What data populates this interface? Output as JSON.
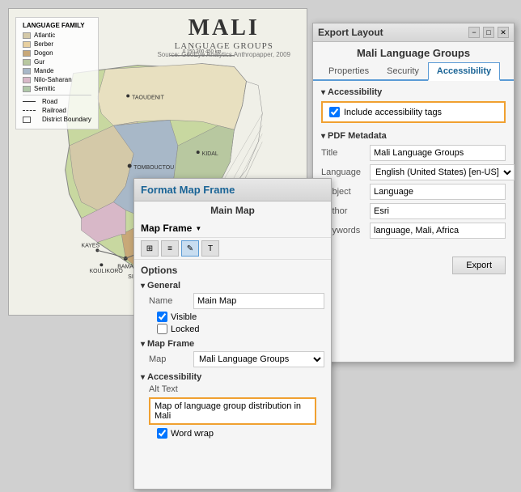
{
  "mali_map": {
    "title": "MALI",
    "subtitle": "LANGUAGE GROUPS",
    "source": "Source: GeoEye Analytics Anthropapper, 2009",
    "legend": {
      "title": "LANGUAGE FAMILY",
      "items": [
        {
          "color": "#d4c9a8",
          "label": "Atlantic"
        },
        {
          "color": "#e8d0a0",
          "label": "Berber"
        },
        {
          "color": "#c8a878",
          "label": "Dogon"
        },
        {
          "color": "#b8c8a0",
          "label": "Gur"
        },
        {
          "color": "#a8b8c8",
          "label": "Mande"
        },
        {
          "color": "#d8b8c8",
          "label": "Nilo-Saharan"
        },
        {
          "color": "#b0c8a8",
          "label": "Semitic"
        }
      ],
      "lines": [
        {
          "style": "solid",
          "label": "Road"
        },
        {
          "style": "dashed",
          "label": "Railroad"
        },
        {
          "style": "border",
          "label": "District Boundary"
        }
      ]
    }
  },
  "format_panel": {
    "title": "Format Map Frame",
    "subtitle": "Main Map",
    "mapframe_label": "Map Frame",
    "toolbar_icons": [
      "grid-icon",
      "list-icon",
      "pencil-icon",
      "text-icon"
    ],
    "options_title": "Options",
    "general_section": "General",
    "name_label": "Name",
    "name_value": "Main Map",
    "visible_label": "Visible",
    "locked_label": "Locked",
    "mapframe_section": "Map Frame",
    "map_label": "Map",
    "map_value": "Mali Language Groups",
    "accessibility_section": "Accessibility",
    "alt_text_label": "Alt Text",
    "alt_text_value": "Map of language group distribution in Mali",
    "word_wrap_label": "Word wrap"
  },
  "export_panel": {
    "title": "Export Layout",
    "map_name": "Mali Language Groups",
    "tabs": [
      {
        "label": "Properties",
        "active": false
      },
      {
        "label": "Security",
        "active": false
      },
      {
        "label": "Accessibility",
        "active": true
      }
    ],
    "accessibility_section": "Accessibility",
    "include_tags_label": "Include accessibility tags",
    "pdf_metadata_section": "PDF Metadata",
    "fields": [
      {
        "label": "Title",
        "value": "Mali Language Groups",
        "type": "input"
      },
      {
        "label": "Language",
        "value": "English (United States) [en-US]",
        "type": "select"
      },
      {
        "label": "Subject",
        "value": "Language",
        "type": "input"
      },
      {
        "label": "Author",
        "value": "Esri",
        "type": "input"
      },
      {
        "label": "Keywords",
        "value": "language, Mali, Africa",
        "type": "input"
      }
    ],
    "export_button": "Export"
  }
}
